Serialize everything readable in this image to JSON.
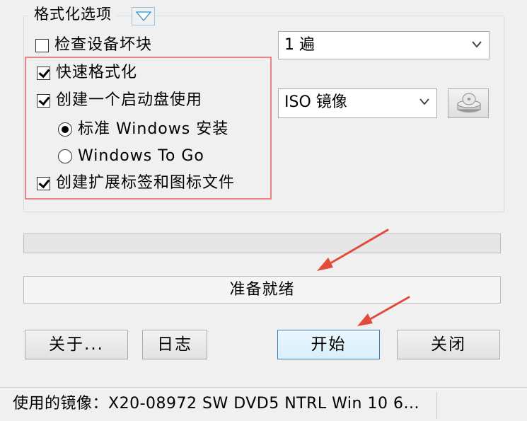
{
  "format_options": {
    "title": "格式化选项",
    "bad_blocks_label": "检查设备坏块",
    "bad_blocks_checked": false,
    "passes_value": "1 遍",
    "quick_format_label": "快速格式化",
    "quick_format_checked": true,
    "bootable_label": "创建一个启动盘使用",
    "bootable_checked": true,
    "boot_type_value": "ISO 镜像",
    "radio_standard_label": "标准 Windows 安装",
    "radio_standard_selected": true,
    "radio_wtg_label": "Windows To Go",
    "radio_wtg_selected": false,
    "ext_label_label": "创建扩展标签和图标文件",
    "ext_label_checked": true
  },
  "progress": {
    "value": 0
  },
  "status_text": "准备就绪",
  "buttons": {
    "about": "关于...",
    "log": "日志",
    "start": "开始",
    "close": "关闭"
  },
  "statusbar": {
    "image_text": "使用的镜像：X20-08972 SW DVD5 NTRL Win 10 6..."
  },
  "colors": {
    "annotation_red": "#e24b3b",
    "highlight_border": "#e78585"
  },
  "icons": {
    "expand": "chevron-down-icon",
    "drive": "disk-drive-icon"
  }
}
